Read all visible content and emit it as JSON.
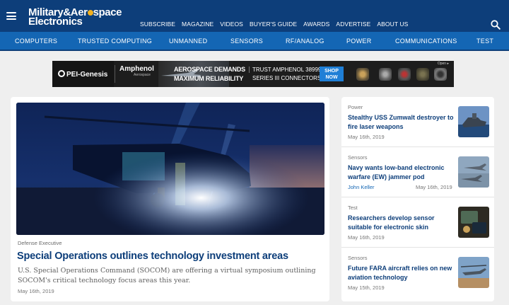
{
  "header": {
    "logo_line1": "Military",
    "logo_amp": "&",
    "logo_line1b": "Aer",
    "logo_line1c": "space",
    "logo_line2": "Electronics",
    "nav": [
      "SUBSCRIBE",
      "MAGAZINE",
      "VIDEOS",
      "BUYER'S GUIDE",
      "AWARDS",
      "ADVERTISE",
      "ABOUT US"
    ]
  },
  "categories": [
    "COMPUTERS",
    "TRUSTED COMPUTING",
    "UNMANNED",
    "SENSORS",
    "RF/ANALOG",
    "POWER",
    "COMMUNICATIONS",
    "TEST"
  ],
  "ad": {
    "brand1": "PEI-Genesis",
    "brand2": "Amphenol",
    "brand2_sub": "Aerospace",
    "headline1": "AEROSPACE DEMANDS",
    "headline2": "MAXIMUM RELIABILITY",
    "sub1": "TRUST AMPHENOL 38999",
    "sub2": "SERIES III CONNECTORS",
    "cta": "SHOP NOW",
    "badge": "Open ▸"
  },
  "main_article": {
    "category": "Defense Executive",
    "title": "Special Operations outlines technology investment areas",
    "description": "U.S. Special Operations Command (SOCOM) are offering a virtual symposium outlining SOCOM's critical technology focus areas this year.",
    "date": "May 16th, 2019"
  },
  "sidebar": [
    {
      "category": "Power",
      "title": "Stealthy USS Zumwalt destroyer to fire laser weapons",
      "author": "",
      "date": "May 16th, 2019"
    },
    {
      "category": "Sensors",
      "title": "Navy wants low-band electronic warfare (EW) jammer pod",
      "author": "John Keller",
      "date": "May 16th, 2019"
    },
    {
      "category": "Test",
      "title": "Researchers develop sensor suitable for electronic skin",
      "author": "",
      "date": "May 16th, 2019"
    },
    {
      "category": "Sensors",
      "title": "Future FARA aircraft relies on new aviation technology",
      "author": "",
      "date": "May 15th, 2019"
    }
  ],
  "colors": {
    "header_bg": "#0d3e7a",
    "catbar_bg": "#1466b4",
    "title_color": "#0d3e7a",
    "accent_dot": "#f2b01e"
  },
  "icons": {
    "menu": "hamburger-icon",
    "search": "search-icon"
  }
}
